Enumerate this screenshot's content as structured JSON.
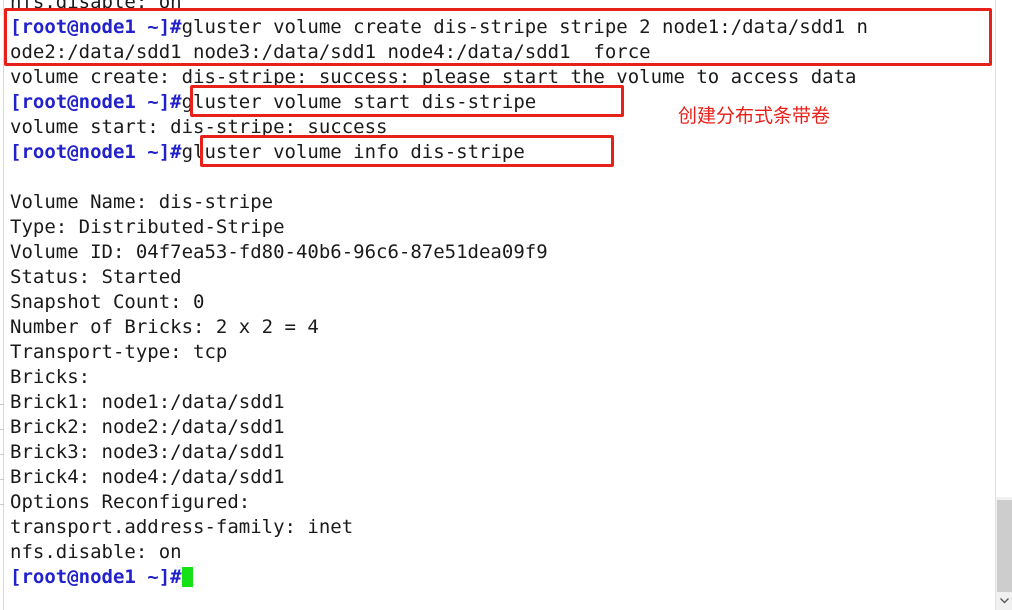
{
  "terminal": {
    "prompt": "[root@node1 ~]#",
    "cursor_color": "#16e016",
    "prompt_color": "#2222cc",
    "text_color": "#1a1a1a",
    "background": "#ffffff",
    "lines": {
      "clipped_top": "nfs.disable: on",
      "cmd_create": "gluster volume create dis-stripe stripe 2 node1:/data/sdd1 n",
      "cmd_create_wrap": "ode2:/data/sdd1 node3:/data/sdd1 node4:/data/sdd1  force",
      "out_create": "volume create: dis-stripe: success: please start the volume to access data",
      "cmd_start": "gluster volume start dis-stripe",
      "out_start": "volume start: dis-stripe: success",
      "cmd_info": "gluster volume info dis-stripe",
      "blank": "",
      "info_volume_name": "Volume Name: dis-stripe",
      "info_type": "Type: Distributed-Stripe",
      "info_volume_id": "Volume ID: 04f7ea53-fd80-40b6-96c6-87e51dea09f9",
      "info_status": "Status: Started",
      "info_snapshot_count": "Snapshot Count: 0",
      "info_number_of_bricks": "Number of Bricks: 2 x 2 = 4",
      "info_transport_type": "Transport-type: tcp",
      "info_bricks_label": "Bricks:",
      "info_brick1": "Brick1: node1:/data/sdd1",
      "info_brick2": "Brick2: node2:/data/sdd1",
      "info_brick3": "Brick3: node3:/data/sdd1",
      "info_brick4": "Brick4: node4:/data/sdd1",
      "info_options_label": "Options Reconfigured:",
      "info_transport_address_family": "transport.address-family: inet",
      "info_nfs_disable": "nfs.disable: on"
    }
  },
  "annotations": {
    "color": "#e8201a",
    "chinese_note": "创建分布式条带卷",
    "box_create_label": "gluster volume create dis-stripe",
    "box_start_label": "gluster volume start dis-stripe",
    "box_info_label": "gluster volume info dis-stripe"
  },
  "scrollbar": {
    "thumb_color": "#cdcdcd",
    "track_color": "#f0f0f0",
    "down_arrow_icon": "chevron-down-icon"
  }
}
